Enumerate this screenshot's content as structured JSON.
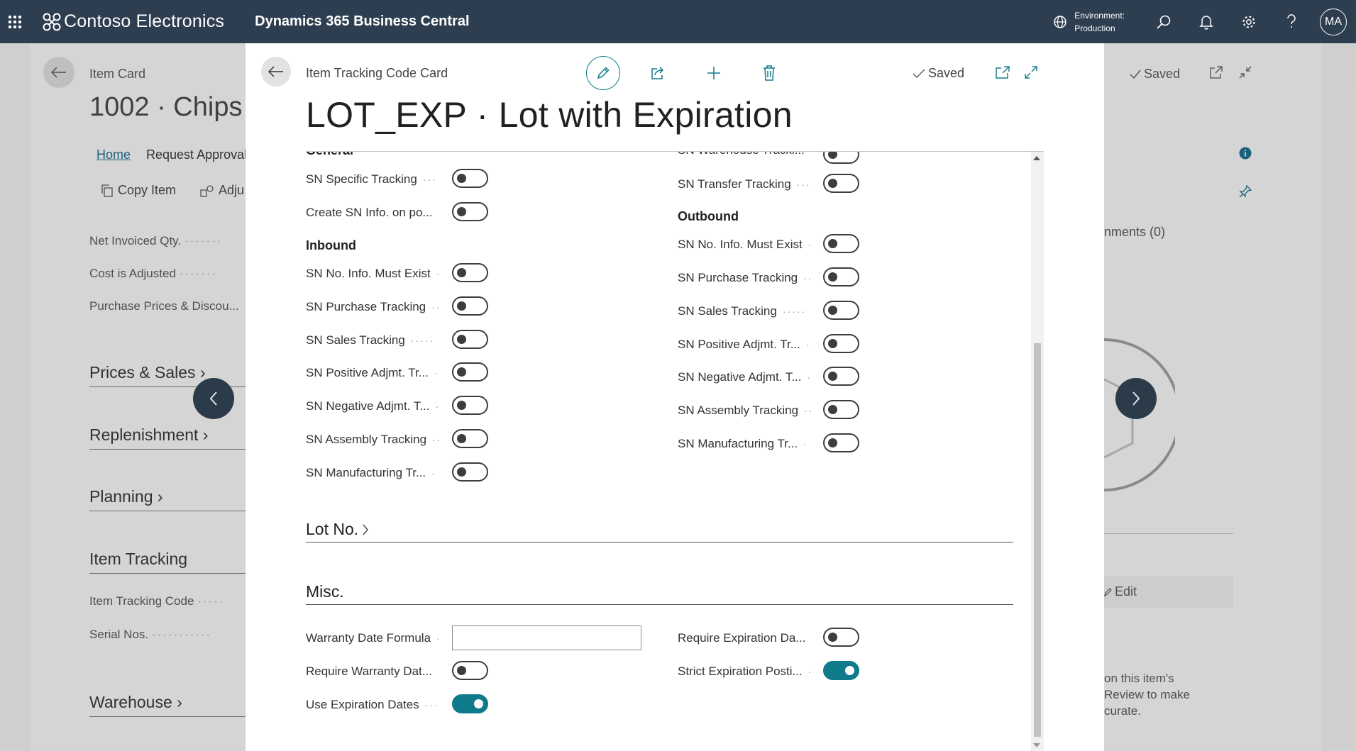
{
  "topbar": {
    "brand": "Contoso Electronics",
    "product": "Dynamics 365 Business Central",
    "environment_label": "Environment:",
    "environment_value": "Production",
    "user_initials": "MA",
    "bg_color": "#2d3e50"
  },
  "background": {
    "breadcrumb": "Item Card",
    "title": "1002 · Chips",
    "tabs": [
      "Home",
      "Request Approval"
    ],
    "actions": [
      "Copy Item",
      "Adju"
    ],
    "fields": [
      "Net Invoiced Qty.",
      "Cost is Adjusted",
      "Purchase Prices & Discou..."
    ],
    "sections": [
      "Prices & Sales",
      "Replenishment",
      "Planning",
      "Item Tracking",
      "Warehouse"
    ],
    "item_tracking_fields": [
      "Item Tracking Code",
      "Serial Nos."
    ],
    "right_saved": "Saved",
    "right_comments": "nments (0)",
    "right_edit": "Edit",
    "right_text_lines": [
      "on this item's",
      "Review to make",
      "curate."
    ]
  },
  "dialog": {
    "breadcrumb": "Item Tracking Code Card",
    "title": "LOT_EXP · Lot with Expiration",
    "saved_label": "Saved",
    "accent_color": "#0e7a8a",
    "left_column": {
      "partial_header": "General",
      "rows_top": [
        {
          "label": "SN Specific Tracking",
          "on": false
        },
        {
          "label": "Create SN Info. on po...",
          "on": false
        }
      ],
      "inbound_header": "Inbound",
      "inbound_rows": [
        {
          "label": "SN No. Info. Must Exist",
          "on": false
        },
        {
          "label": "SN Purchase Tracking",
          "on": false
        },
        {
          "label": "SN Sales Tracking",
          "on": false
        },
        {
          "label": "SN Positive Adjmt. Tr...",
          "on": false
        },
        {
          "label": "SN Negative Adjmt. T...",
          "on": false
        },
        {
          "label": "SN Assembly Tracking",
          "on": false
        },
        {
          "label": "SN Manufacturing Tr...",
          "on": false
        }
      ]
    },
    "right_column": {
      "partial_row": "SN Warehouse Tracki...",
      "rows_top": [
        {
          "label": "SN Transfer Tracking",
          "on": false
        }
      ],
      "outbound_header": "Outbound",
      "outbound_rows": [
        {
          "label": "SN No. Info. Must Exist",
          "on": false
        },
        {
          "label": "SN Purchase Tracking",
          "on": false
        },
        {
          "label": "SN Sales Tracking",
          "on": false
        },
        {
          "label": "SN Positive Adjmt. Tr...",
          "on": false
        },
        {
          "label": "SN Negative Adjmt. T...",
          "on": false
        },
        {
          "label": "SN Assembly Tracking",
          "on": false
        },
        {
          "label": "SN Manufacturing Tr...",
          "on": false
        }
      ]
    },
    "lot_section": "Lot No.",
    "misc_section": "Misc.",
    "misc_left": [
      {
        "label": "Warranty Date Formula",
        "type": "input",
        "value": ""
      },
      {
        "label": "Require Warranty Dat...",
        "type": "toggle",
        "on": false
      },
      {
        "label": "Use Expiration Dates",
        "type": "toggle",
        "on": true
      }
    ],
    "misc_right": [
      {
        "label": "Require Expiration Da...",
        "type": "toggle",
        "on": false
      },
      {
        "label": "Strict Expiration Posti...",
        "type": "toggle",
        "on": true
      }
    ]
  }
}
